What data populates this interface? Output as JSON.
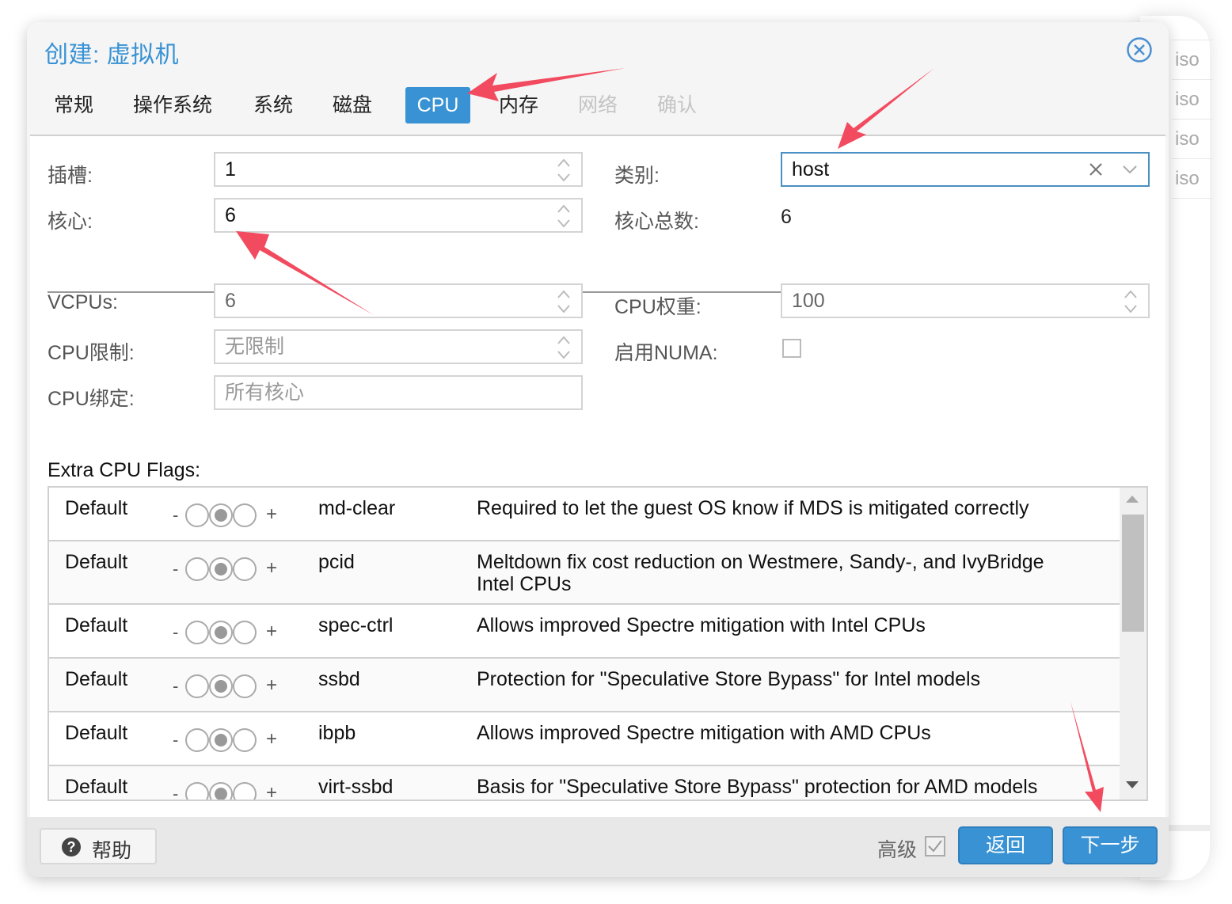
{
  "background": {
    "list_items": [
      "iso",
      "iso",
      "iso",
      "iso"
    ]
  },
  "dialog": {
    "title": "创建: 虚拟机",
    "close_icon": "circle-x-icon",
    "tabs": [
      {
        "label": "常规",
        "state": "normal"
      },
      {
        "label": "操作系统",
        "state": "normal"
      },
      {
        "label": "系统",
        "state": "normal"
      },
      {
        "label": "磁盘",
        "state": "normal"
      },
      {
        "label": "CPU",
        "state": "active"
      },
      {
        "label": "内存",
        "state": "normal"
      },
      {
        "label": "网络",
        "state": "disabled"
      },
      {
        "label": "确认",
        "state": "disabled"
      }
    ]
  },
  "form": {
    "sockets": {
      "label": "插槽:",
      "value": "1"
    },
    "cores": {
      "label": "核心:",
      "value": "6"
    },
    "type": {
      "label": "类别:",
      "value": "host"
    },
    "total_cores": {
      "label": "核心总数:",
      "value": "6"
    },
    "vcpus": {
      "label": "VCPUs:",
      "value": "6"
    },
    "cpu_limit": {
      "label": "CPU限制:",
      "placeholder": "无限制"
    },
    "cpu_affinity": {
      "label": "CPU绑定:",
      "placeholder": "所有核心"
    },
    "cpu_units": {
      "label": "CPU权重:",
      "value": "100"
    },
    "numa": {
      "label": "启用NUMA:",
      "checked": false
    }
  },
  "flags": {
    "label": "Extra CPU Flags:",
    "minus": "-",
    "plus": "+",
    "rows": [
      {
        "state": "Default",
        "name": "md-clear",
        "description": "Required to let the guest OS know if MDS is mitigated correctly"
      },
      {
        "state": "Default",
        "name": "pcid",
        "description": "Meltdown fix cost reduction on Westmere, Sandy-, and IvyBridge Intel CPUs"
      },
      {
        "state": "Default",
        "name": "spec-ctrl",
        "description": "Allows improved Spectre mitigation with Intel CPUs"
      },
      {
        "state": "Default",
        "name": "ssbd",
        "description": "Protection for \"Speculative Store Bypass\" for Intel models"
      },
      {
        "state": "Default",
        "name": "ibpb",
        "description": "Allows improved Spectre mitigation with AMD CPUs"
      },
      {
        "state": "Default",
        "name": "virt-ssbd",
        "description": "Basis for \"Speculative Store Bypass\" protection for AMD models"
      }
    ]
  },
  "footer": {
    "help_label": "帮助",
    "help_icon": "?",
    "advanced_label": "高级",
    "advanced_checked": true,
    "back_label": "返回",
    "next_label": "下一步"
  },
  "annotations": {
    "arrow_color": "#f24b5f"
  },
  "colors": {
    "accent": "#3892d4",
    "disabled_tab": "#c4c4c4"
  }
}
